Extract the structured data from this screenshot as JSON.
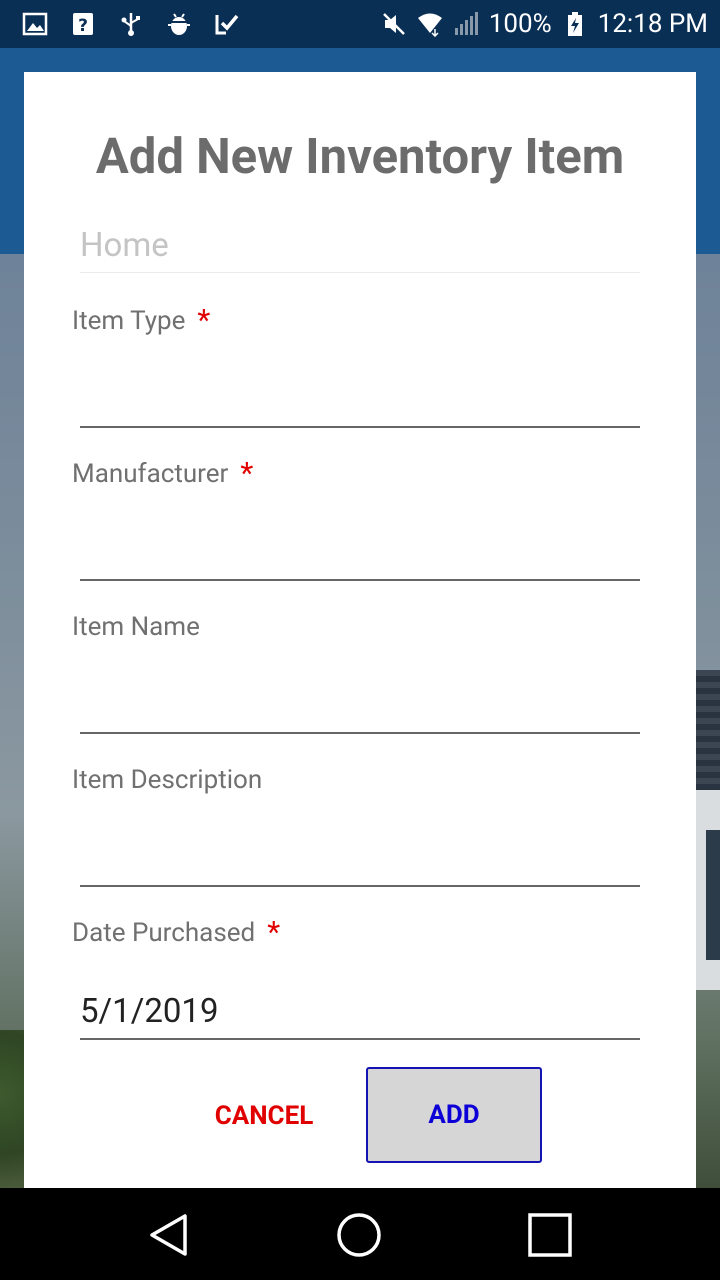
{
  "status_bar": {
    "left_icons": [
      "image-icon",
      "help-box-icon",
      "usb-icon",
      "android-bug-icon",
      "checklist-icon"
    ],
    "right_icons": [
      "mute-icon",
      "wifi-icon",
      "signal-icon"
    ],
    "battery": "100%",
    "time": "12:18 PM"
  },
  "dialog": {
    "title": "Add New Inventory Item",
    "home_placeholder": "Home",
    "fields": [
      {
        "label": "Item Type",
        "required": "*",
        "value": ""
      },
      {
        "label": "Manufacturer",
        "required": "*",
        "value": ""
      },
      {
        "label": "Item Name",
        "value": ""
      },
      {
        "label": "Item Description",
        "value": ""
      },
      {
        "label": "Date Purchased",
        "required": "*",
        "value": "5/1/2019"
      }
    ],
    "cancel_label": "CANCEL",
    "add_label": "ADD"
  },
  "nav_bar": {
    "icons": [
      "back-triangle-icon",
      "home-circle-icon",
      "recents-square-icon"
    ]
  },
  "colors": {
    "status_bar": "#0a2f55",
    "header": "#1c5a94",
    "required": "#e00000",
    "cancel": "#e00000",
    "add_text": "#0d00d6",
    "add_bg": "#d6d6d6"
  }
}
